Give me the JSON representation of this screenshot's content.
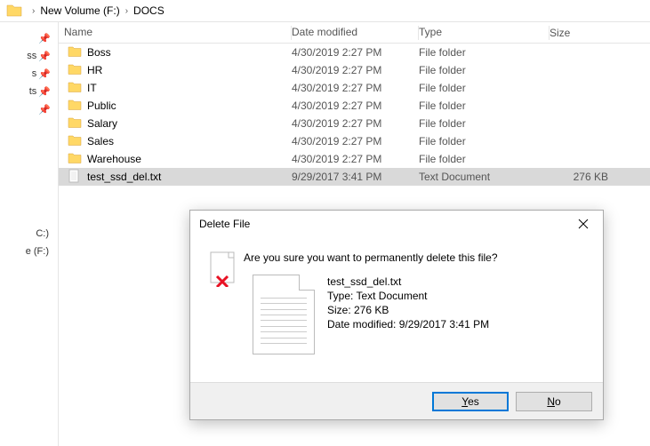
{
  "breadcrumb": {
    "drive": "New Volume (F:)",
    "folder": "DOCS"
  },
  "nav": {
    "items": [
      "ss",
      "s",
      "ts",
      ""
    ],
    "drive_c_label": "C:)",
    "drive_f_label": "e (F:)"
  },
  "headers": {
    "name": "Name",
    "date": "Date modified",
    "type": "Type",
    "size": "Size"
  },
  "rows": [
    {
      "name": "Boss",
      "date": "4/30/2019 2:27 PM",
      "type": "File folder",
      "size": "",
      "kind": "folder",
      "selected": false
    },
    {
      "name": "HR",
      "date": "4/30/2019 2:27 PM",
      "type": "File folder",
      "size": "",
      "kind": "folder",
      "selected": false
    },
    {
      "name": "IT",
      "date": "4/30/2019 2:27 PM",
      "type": "File folder",
      "size": "",
      "kind": "folder",
      "selected": false
    },
    {
      "name": "Public",
      "date": "4/30/2019 2:27 PM",
      "type": "File folder",
      "size": "",
      "kind": "folder",
      "selected": false
    },
    {
      "name": "Salary",
      "date": "4/30/2019 2:27 PM",
      "type": "File folder",
      "size": "",
      "kind": "folder",
      "selected": false
    },
    {
      "name": "Sales",
      "date": "4/30/2019 2:27 PM",
      "type": "File folder",
      "size": "",
      "kind": "folder",
      "selected": false
    },
    {
      "name": "Warehouse",
      "date": "4/30/2019 2:27 PM",
      "type": "File folder",
      "size": "",
      "kind": "folder",
      "selected": false
    },
    {
      "name": "test_ssd_del.txt",
      "date": "9/29/2017 3:41 PM",
      "type": "Text Document",
      "size": "276 KB",
      "kind": "file",
      "selected": true
    }
  ],
  "dialog": {
    "title": "Delete File",
    "message": "Are you sure you want to permanently delete this file?",
    "filename": "test_ssd_del.txt",
    "type_label": "Type: Text Document",
    "size_label": "Size: 276 KB",
    "date_label": "Date modified: 9/29/2017 3:41 PM",
    "yes": "Yes",
    "no": "No"
  }
}
